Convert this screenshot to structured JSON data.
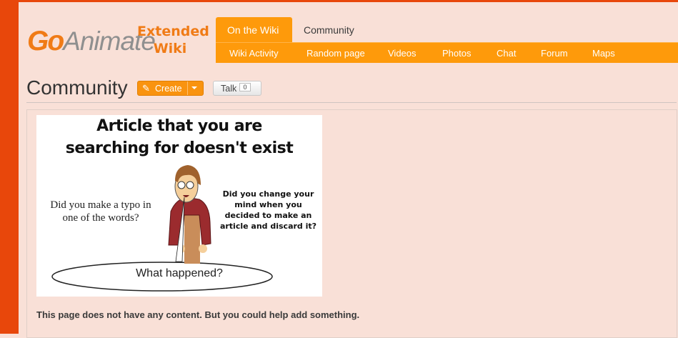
{
  "logo": {
    "go": "Go",
    "animate": "Animate",
    "line1": "Extended",
    "line2": "Wiki"
  },
  "nav": {
    "tabs": [
      {
        "label": "On the Wiki",
        "active": true
      },
      {
        "label": "Community",
        "active": false
      }
    ],
    "subnav": [
      "Wiki Activity",
      "Random page",
      "Videos",
      "Photos",
      "Chat",
      "Forum",
      "Maps"
    ]
  },
  "page": {
    "title": "Community",
    "create_label": "Create",
    "talk_label": "Talk",
    "talk_count": "0"
  },
  "image": {
    "heading1": "Article that you are",
    "heading2": "searching for doesn't exist",
    "left_text": "Did you make a typo in one of the words?",
    "right_text": "Did you change your mind when you decided to make an article and discard it?",
    "bubble_text": "What happened?"
  },
  "message": "This page does not have any content. But you could help add something.",
  "colors": {
    "accent": "#fe9a0b",
    "sidebar": "#e8470b",
    "background": "#f9e0d7"
  }
}
